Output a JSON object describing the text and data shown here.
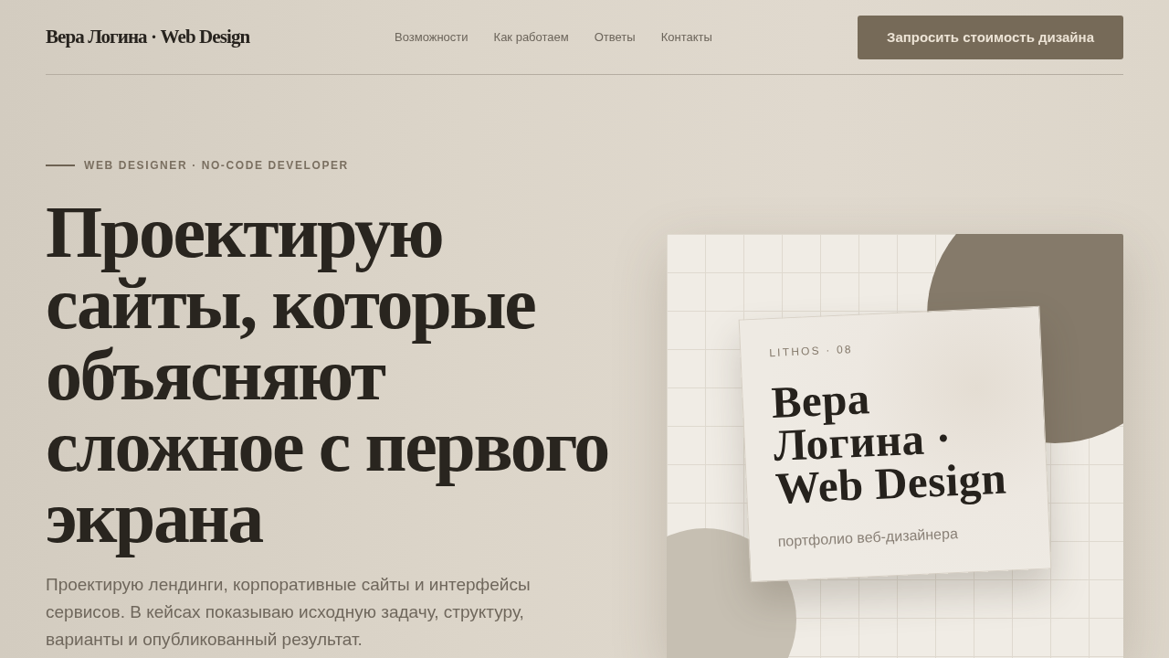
{
  "header": {
    "logo": "Вера Логина · Web Design",
    "nav": [
      "Возможности",
      "Как работаем",
      "Ответы",
      "Контакты"
    ],
    "cta": "Запросить стоимость дизайна"
  },
  "hero": {
    "eyebrow": "WEB DESIGNER · NO-CODE DEVELOPER",
    "headline": "Проектирую сайты, которые объясняют сложное с первого экрана",
    "description": "Проектирую лендинги, корпоративные сайты и интерфейсы сервисов. В кейсах показываю исходную задачу, структуру, варианты и опубликованный результат."
  },
  "preview_card": {
    "label": "LITHOS · 08",
    "title": "Вера Логина · Web Design",
    "subtitle": "портфолио веб-дизайнера"
  }
}
